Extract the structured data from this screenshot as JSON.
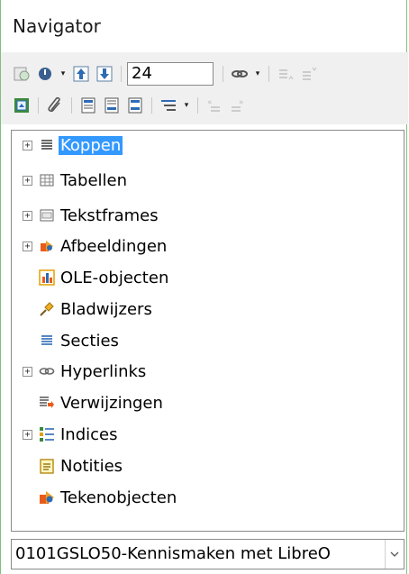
{
  "window": {
    "title": "Navigator"
  },
  "toolbar": {
    "row1": [
      {
        "icon": "navigation-toggle-icon"
      },
      {
        "icon": "navigate-by-icon",
        "dropdown": true
      },
      {
        "icon": "previous-object-icon"
      },
      {
        "icon": "next-object-icon"
      },
      {
        "sep": true
      },
      {
        "input": true
      },
      {
        "sep": true
      },
      {
        "icon": "drag-mode-icon",
        "dropdown": true
      },
      {
        "sep": true
      },
      {
        "icon": "promote-level-icon"
      },
      {
        "icon": "demote-level-icon"
      }
    ],
    "row2": [
      {
        "icon": "content-view-icon"
      },
      {
        "sep": true
      },
      {
        "icon": "set-reminder-icon"
      },
      {
        "sep": true
      },
      {
        "icon": "header-icon"
      },
      {
        "icon": "footer-icon"
      },
      {
        "icon": "anchor-text-icon"
      },
      {
        "sep": true
      },
      {
        "icon": "heading-levels-icon",
        "dropdown": true
      },
      {
        "sep": true
      },
      {
        "icon": "promote-chapter-icon"
      },
      {
        "icon": "demote-chapter-icon"
      }
    ],
    "page_number": "24"
  },
  "tree": {
    "items": [
      {
        "label": "Koppen",
        "expandable": true,
        "selected": true,
        "icon": "headings-icon"
      },
      {
        "label": "Tabellen",
        "expandable": true,
        "selected": false,
        "icon": "table-icon"
      },
      {
        "label": "Tekstframes",
        "expandable": true,
        "selected": false,
        "icon": "text-frame-icon"
      },
      {
        "label": "Afbeeldingen",
        "expandable": true,
        "selected": false,
        "icon": "image-icon"
      },
      {
        "label": "OLE-objecten",
        "expandable": false,
        "selected": false,
        "icon": "ole-object-icon"
      },
      {
        "label": "Bladwijzers",
        "expandable": false,
        "selected": false,
        "icon": "bookmark-icon"
      },
      {
        "label": "Secties",
        "expandable": false,
        "selected": false,
        "icon": "section-icon"
      },
      {
        "label": "Hyperlinks",
        "expandable": true,
        "selected": false,
        "icon": "hyperlink-icon"
      },
      {
        "label": "Verwijzingen",
        "expandable": false,
        "selected": false,
        "icon": "reference-icon"
      },
      {
        "label": "Indices",
        "expandable": true,
        "selected": false,
        "icon": "index-icon"
      },
      {
        "label": "Notities",
        "expandable": false,
        "selected": false,
        "icon": "comment-icon"
      },
      {
        "label": "Tekenobjecten",
        "expandable": false,
        "selected": false,
        "icon": "drawing-object-icon"
      }
    ]
  },
  "document_select": {
    "value": "0101GSLO50-Kennismaken met LibreO"
  },
  "colors": {
    "selection": "#3399ff",
    "toolbar_bg": "#f0f0f0",
    "window_border": "#7fbf7f"
  }
}
